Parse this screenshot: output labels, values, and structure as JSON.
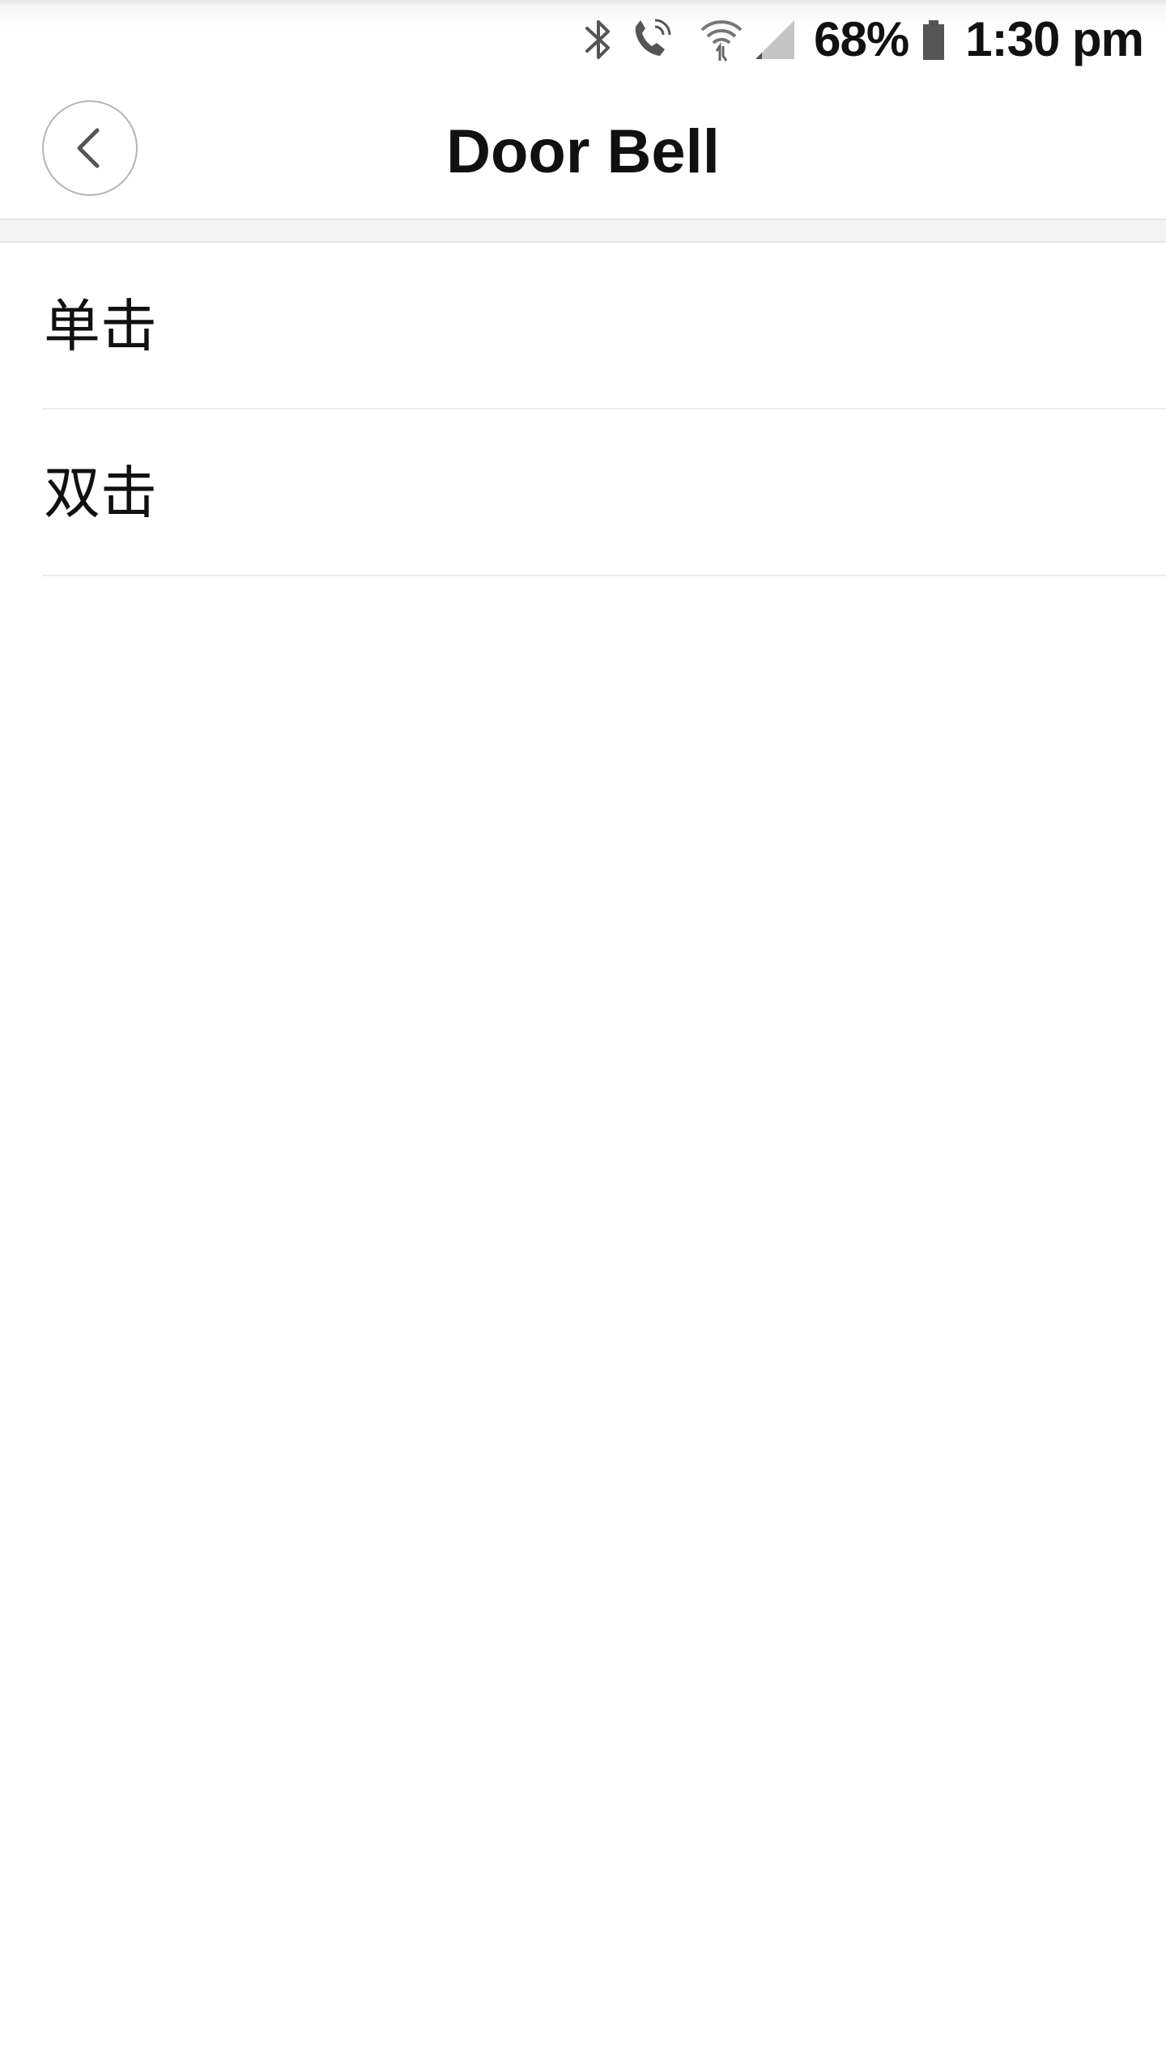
{
  "status_bar": {
    "battery_percent": "68%",
    "time": "1:30 pm",
    "icons": [
      "bluetooth-icon",
      "wifi-calling-icon",
      "wifi-icon",
      "cell-signal-icon",
      "battery-icon"
    ]
  },
  "header": {
    "title": "Door Bell",
    "back_icon": "chevron-left-icon"
  },
  "list": {
    "items": [
      {
        "label": "单击"
      },
      {
        "label": "双击"
      }
    ]
  }
}
